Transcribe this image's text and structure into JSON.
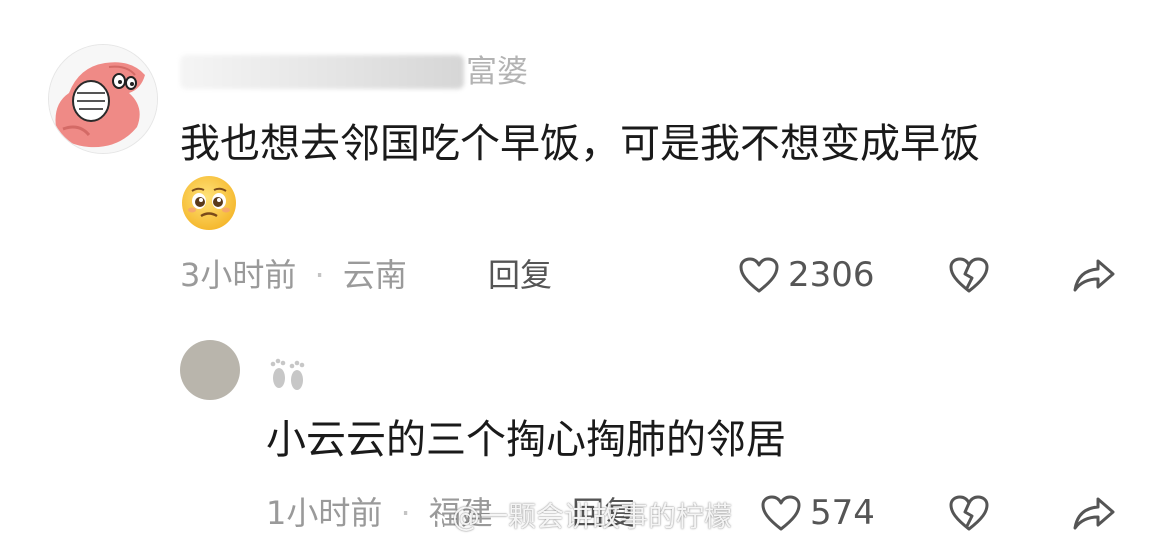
{
  "comment": {
    "username_suffix": "富婆",
    "text": "我也想去邻国吃个早饭，可是我不想变成早饭",
    "time": "3小时前",
    "separator": "·",
    "location": "云南",
    "reply_label": "回复",
    "likes": "2306"
  },
  "reply": {
    "text": "小云云的三个掏心掏肺的邻居",
    "time": "1小时前",
    "location": "福建",
    "reply_label": "回复",
    "likes": "574"
  },
  "watermark": "@一颗会讲故事的柠檬",
  "icons": {
    "main_avatar": "patrick-star-avatar",
    "emoji": "pleading-face-emoji",
    "reply_badge": "footprints-icon",
    "like": "heart-outline-icon",
    "dislike": "broken-heart-icon",
    "share": "share-arrow-icon"
  },
  "colors": {
    "text": "#1a1a1a",
    "meta": "#9a9a9a",
    "action": "#555555",
    "avatar_placeholder": "#b9b5ac"
  }
}
